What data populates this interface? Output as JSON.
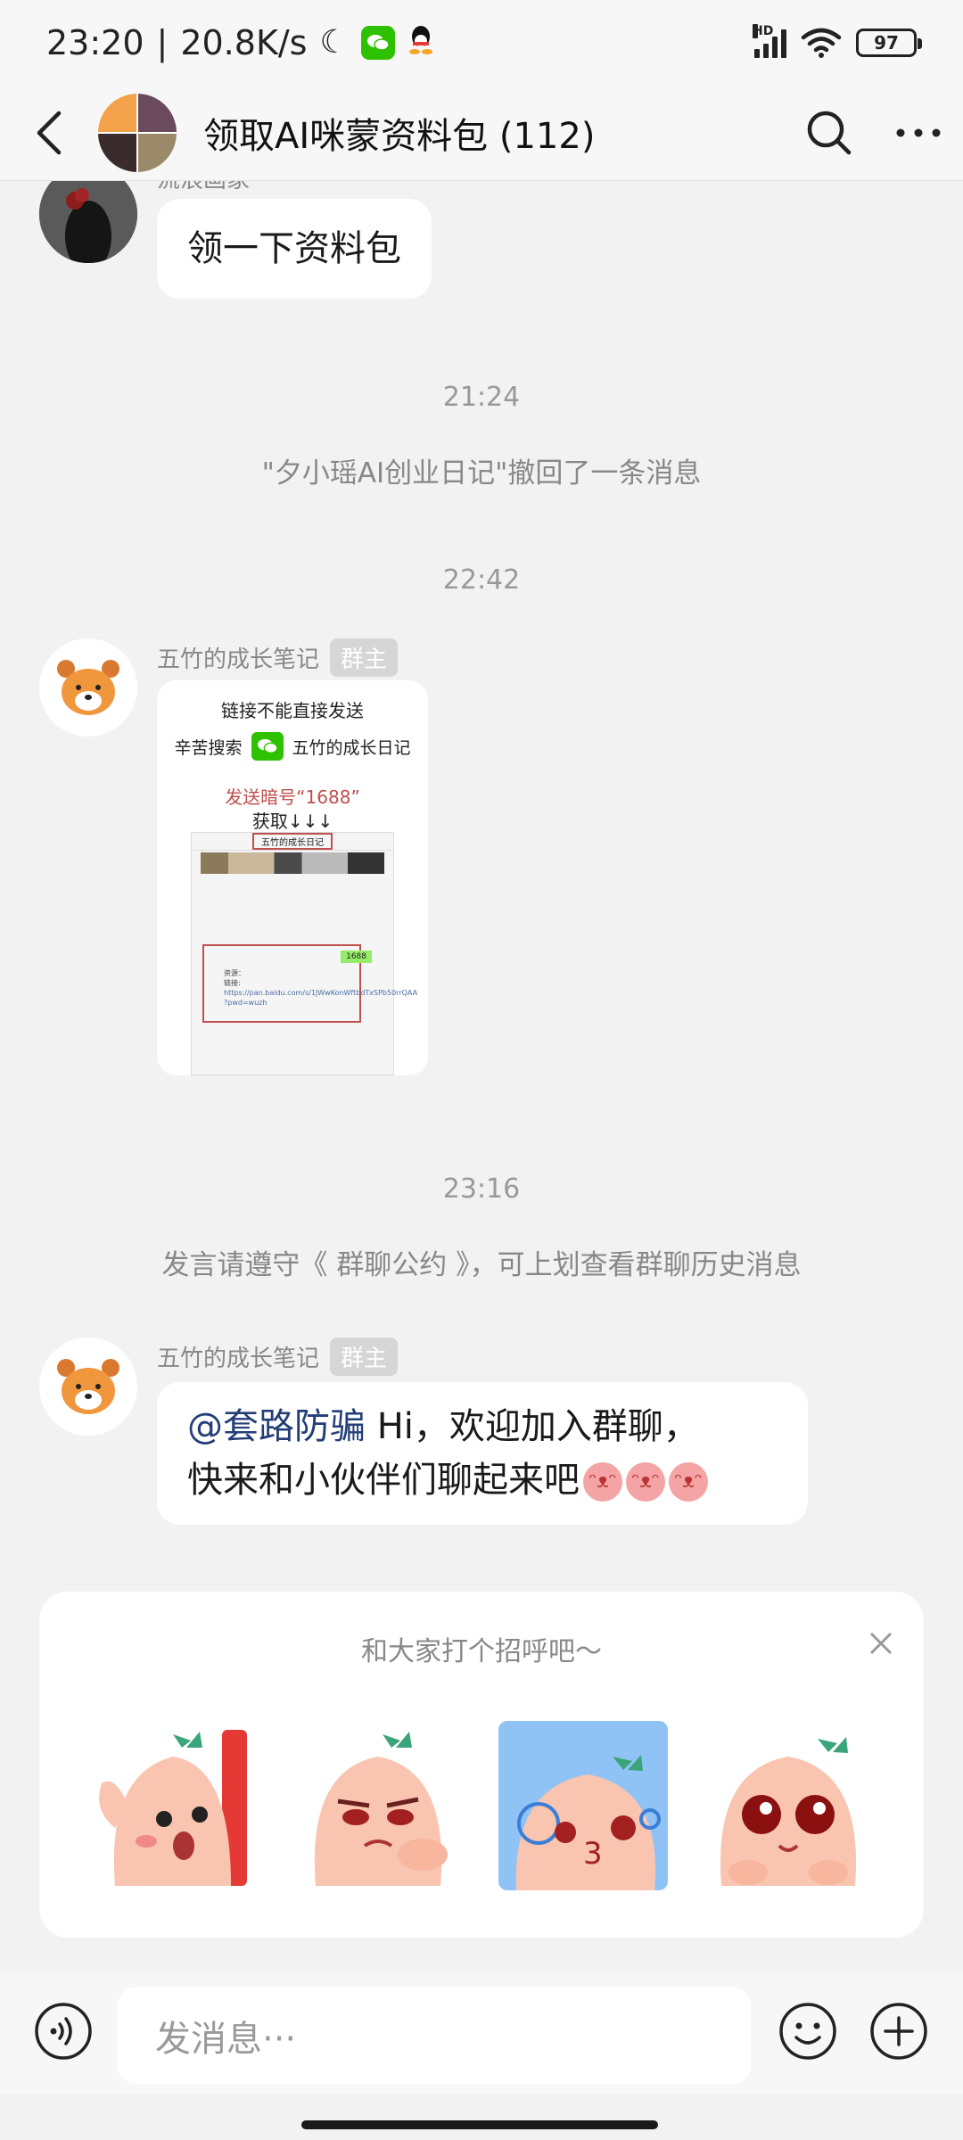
{
  "status_bar": {
    "time": "23:20",
    "net_speed": "20.8K/s",
    "hd_label": "HD",
    "battery": "97"
  },
  "nav": {
    "title": "领取AI咪蒙资料包 (112)"
  },
  "messages": {
    "first_sender_partial": "流浪画家",
    "first_text": "领一下资料包",
    "time_1": "21:24",
    "recall_notice": "\"夕小瑶AI创业日记\"撤回了一条消息",
    "time_2": "22:42",
    "sender_name": "五竹的成长笔记",
    "owner_badge": "群主",
    "image_card": {
      "line1": "链接不能直接发送",
      "line2_left": "辛苦搜索",
      "line2_right": "五竹的成长日记",
      "red_text": "发送暗号“1688”",
      "get_text": "获取↓↓↓",
      "phone_title": "五竹的成长日记",
      "chat_tag": "1688",
      "resource_label": "资源：",
      "link_label": "链接:",
      "link_text": "https://pan.baidu.com/s/1JWwKonWftbdTxSPb50rrQAA",
      "pwd": "?pwd=wuzh"
    },
    "time_3": "23:16",
    "rules_notice": "发言请遵守《 群聊公约 》，可上划查看群聊历史消息",
    "welcome_mention": "@套路防骗",
    "welcome_line1": " Hi，欢迎加入群聊，",
    "welcome_line2": "快来和小伙伴们聊起来吧"
  },
  "greet_card": {
    "title": "和大家打个招呼吧～",
    "stickers": [
      "sticker-wave",
      "sticker-smug",
      "sticker-kiss",
      "sticker-teary"
    ]
  },
  "input_bar": {
    "placeholder": "发消息···"
  },
  "colors": {
    "background": "#f2f2f2",
    "bubble": "#ffffff",
    "mention": "#233e77",
    "owner_badge": "#d6d6d6",
    "wechat_green": "#2dc100"
  }
}
